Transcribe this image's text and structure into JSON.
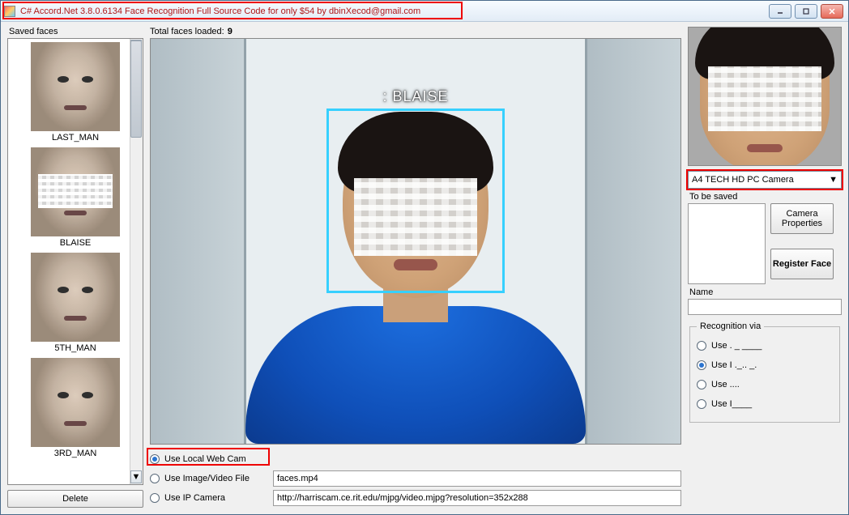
{
  "window": {
    "title": "C# Accord.Net 3.8.0.6134 Face Recognition Full Source Code for only $54 by dbinXecod@gmail.com"
  },
  "left": {
    "saved_label": "Saved faces",
    "delete_label": "Delete",
    "items": [
      {
        "label": "LAST_MAN",
        "pixelated": false
      },
      {
        "label": "BLAISE",
        "pixelated": true
      },
      {
        "label": "5TH_MAN",
        "pixelated": false
      },
      {
        "label": "3RD_MAN",
        "pixelated": false
      }
    ]
  },
  "mid": {
    "total_label": "Total faces loaded:",
    "total_value": "9",
    "detection_label": ": BLAISE",
    "sources": {
      "webcam": {
        "label": "Use Local Web Cam",
        "selected": true
      },
      "file": {
        "label": "Use Image/Video File",
        "value": "faces.mp4",
        "selected": false
      },
      "ipcamera": {
        "label": "Use IP Camera",
        "value": "http://harriscam.ce.rit.edu/mjpg/video.mjpg?resolution=352x288",
        "selected": false
      }
    }
  },
  "right": {
    "camera_selected": "A4 TECH HD PC Camera",
    "to_be_saved_label": "To be saved",
    "camera_props_label": "Camera Properties",
    "register_label": "Register Face",
    "name_label": "Name",
    "recognition": {
      "legend": "Recognition via",
      "options": [
        {
          "label": "Use . _ ____",
          "selected": false
        },
        {
          "label": "Use I ._.. _.",
          "selected": true
        },
        {
          "label": "Use ....",
          "selected": false
        },
        {
          "label": "Use I____",
          "selected": false
        }
      ]
    }
  }
}
